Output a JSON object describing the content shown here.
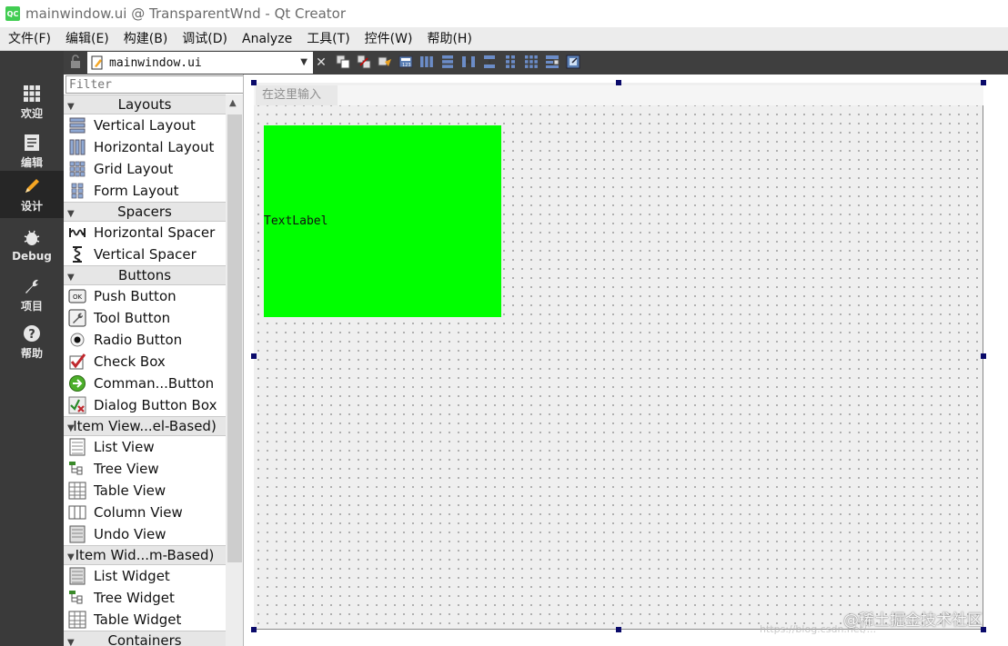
{
  "window": {
    "app_icon": "QC",
    "title": "mainwindow.ui @ TransparentWnd - Qt Creator"
  },
  "menubar": [
    "文件(F)",
    "编辑(E)",
    "构建(B)",
    "调试(D)",
    "Analyze",
    "工具(T)",
    "控件(W)",
    "帮助(H)"
  ],
  "modes": [
    {
      "label": "欢迎",
      "icon": "grid-icon"
    },
    {
      "label": "编辑",
      "icon": "document-icon"
    },
    {
      "label": "设计",
      "icon": "pencil-icon",
      "active": true
    },
    {
      "label": "Debug",
      "icon": "bug-icon"
    },
    {
      "label": "项目",
      "icon": "wrench-icon"
    },
    {
      "label": "帮助",
      "icon": "help-icon"
    }
  ],
  "editor": {
    "file_name": "mainwindow.ui",
    "close_symbol": "✕"
  },
  "widgetbox": {
    "filter_placeholder": "Filter",
    "categories": {
      "layouts": "Layouts",
      "spacers": "Spacers",
      "buttons": "Buttons",
      "item_views": "Item View...el-Based)",
      "item_widgets": "Item Wid...m-Based)",
      "containers": "Containers"
    },
    "items": {
      "vertical_layout": "Vertical Layout",
      "horizontal_layout": "Horizontal Layout",
      "grid_layout": "Grid Layout",
      "form_layout": "Form Layout",
      "horizontal_spacer": "Horizontal Spacer",
      "vertical_spacer": "Vertical Spacer",
      "push_button": "Push Button",
      "tool_button": "Tool Button",
      "radio_button": "Radio Button",
      "check_box": "Check Box",
      "command_button": "Comman...Button",
      "dialog_button_box": "Dialog Button Box",
      "list_view": "List View",
      "tree_view": "Tree View",
      "table_view": "Table View",
      "column_view": "Column View",
      "undo_view": "Undo View",
      "list_widget": "List Widget",
      "tree_widget": "Tree Widget",
      "table_widget": "Table Widget"
    }
  },
  "form": {
    "menu_placeholder": "在这里输入",
    "label_text": "TextLabel",
    "label_bg": "#00ff00"
  },
  "watermark": {
    "text": "@稀土掘金技术社区",
    "url": "https://blog.csdn.net/..."
  }
}
